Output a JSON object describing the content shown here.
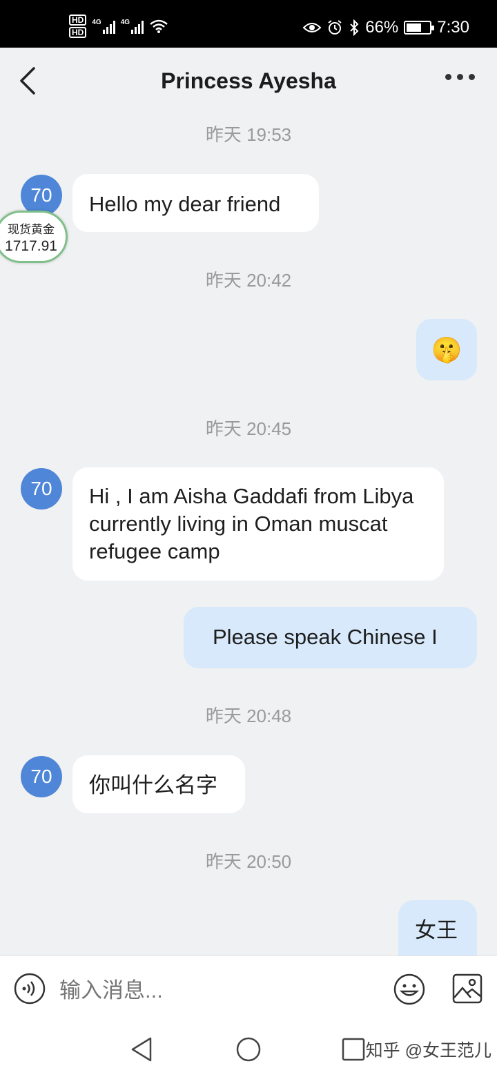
{
  "status_bar": {
    "hd1": "HD",
    "hd2": "HD",
    "net1": "4G",
    "net2": "4G",
    "battery_percent": "66%",
    "battery_level": 0.66,
    "time": "7:30",
    "icons": [
      "eye-icon",
      "alarm-icon",
      "bluetooth-icon",
      "battery-icon",
      "wifi-icon",
      "signal-icon"
    ]
  },
  "header": {
    "title": "Princess Ayesha"
  },
  "overlay": {
    "gold_label": "现货黄金",
    "gold_price": "1717.91"
  },
  "messages": {
    "ts1": "昨天 19:53",
    "avatar1": "70",
    "msg1": "Hello my dear friend",
    "ts2": "昨天 20:42",
    "msg2_emoji": "🤫",
    "ts3": "昨天 20:45",
    "avatar3": "70",
    "msg3": "Hi , I am Aisha Gaddafi from Libya currently living in Oman muscat refugee camp",
    "msg4": "Please speak Chinese I",
    "ts4": "昨天 20:48",
    "avatar5": "70",
    "msg5": "你叫什么名字",
    "ts5": "昨天 20:50",
    "msg6": "女王"
  },
  "input_bar": {
    "placeholder": "输入消息..."
  },
  "nav": {
    "watermark": "知乎 @女王范儿"
  },
  "colors": {
    "background": "#f0f1f3",
    "avatar": "#4f86d8",
    "mine_bubble": "#d7e9fb",
    "their_bubble": "#ffffff"
  }
}
